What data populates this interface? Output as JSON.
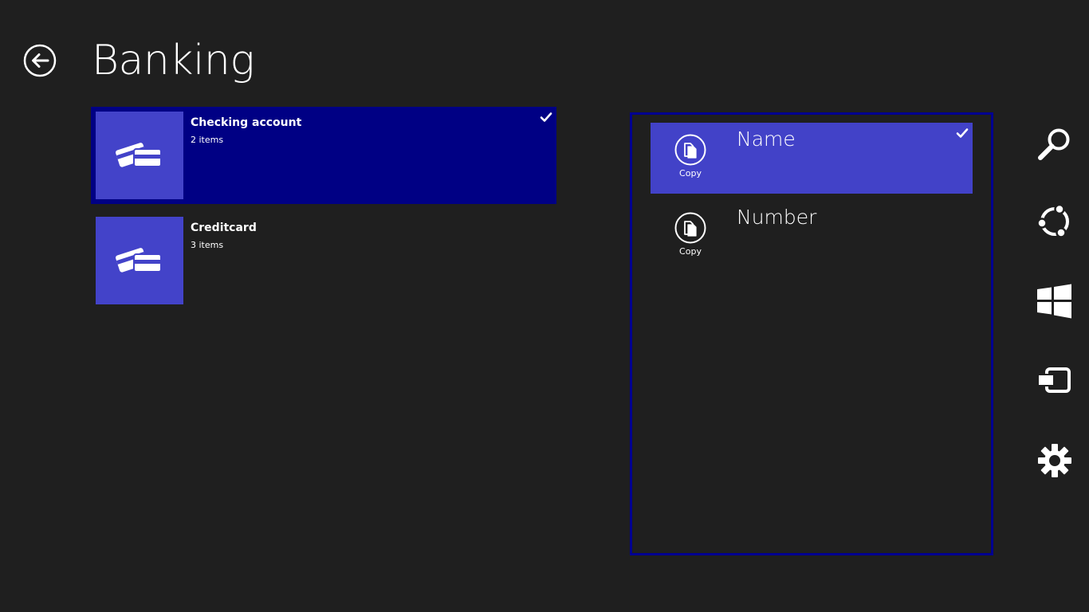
{
  "header": {
    "title": "Banking"
  },
  "accounts": [
    {
      "title": "Checking account",
      "subtitle": "2 items",
      "selected": true,
      "icon": "credit-cards-icon"
    },
    {
      "title": "Creditcard",
      "subtitle": "3 items",
      "selected": false,
      "icon": "credit-cards-icon"
    }
  ],
  "fields": [
    {
      "name": "Name",
      "copy_label": "Copy",
      "selected": true,
      "icon": "copy-icon"
    },
    {
      "name": "Number",
      "copy_label": "Copy",
      "selected": false,
      "icon": "copy-icon"
    }
  ],
  "charms": [
    "search-icon",
    "share-icon",
    "start-icon",
    "devices-icon",
    "settings-icon"
  ],
  "colors": {
    "background": "#1f1f1f",
    "tile_accent": "#4343c9",
    "selected_tile": "#000084",
    "selected_field": "#4242c8",
    "panel_border": "#000090"
  }
}
